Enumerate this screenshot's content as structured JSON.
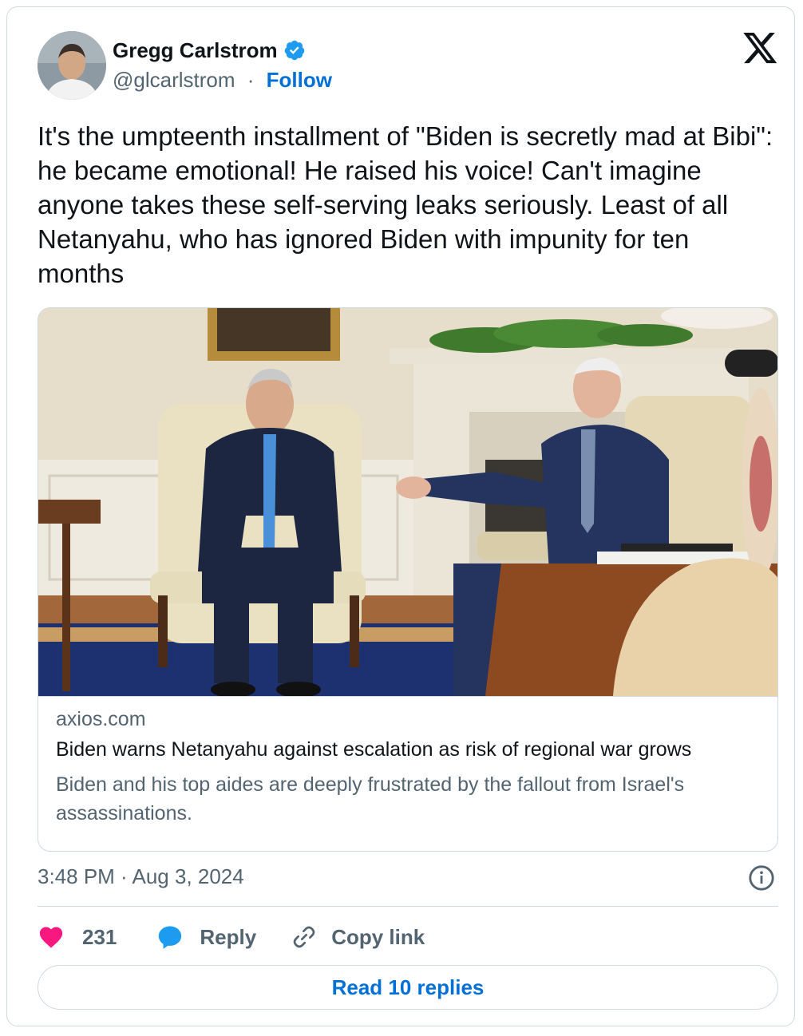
{
  "author": {
    "name": "Gregg Carlstrom",
    "handle": "@glcarlstrom",
    "separator": "·",
    "follow_label": "Follow",
    "verified": true
  },
  "tweet": {
    "text": "It's the umpteenth installment of \"Biden is secretly mad at Bibi\": he became emotional! He raised his voice! Can't imagine anyone takes these self-serving leaks seriously. Least of all Netanyahu, who has ignored Biden with impunity for ten months"
  },
  "link_card": {
    "domain": "axios.com",
    "title": "Biden warns Netanyahu against escalation as risk of regional war grows",
    "description": "Biden and his top aides are deeply frustrated by the fallout from Israel's assassinations."
  },
  "meta": {
    "timestamp": "3:48 PM · Aug 3, 2024"
  },
  "actions": {
    "like_count": "231",
    "reply_label": "Reply",
    "copy_link_label": "Copy link"
  },
  "read_replies_label": "Read 10 replies",
  "colors": {
    "accent": "#006fd6",
    "verified": "#1d9bf0",
    "like": "#f91880",
    "reply": "#1d9bf0",
    "muted": "#536471",
    "border": "#cfd9de"
  },
  "icons": [
    "verified-badge-icon",
    "x-logo-icon",
    "info-icon",
    "heart-icon",
    "reply-bubble-icon",
    "link-icon"
  ]
}
